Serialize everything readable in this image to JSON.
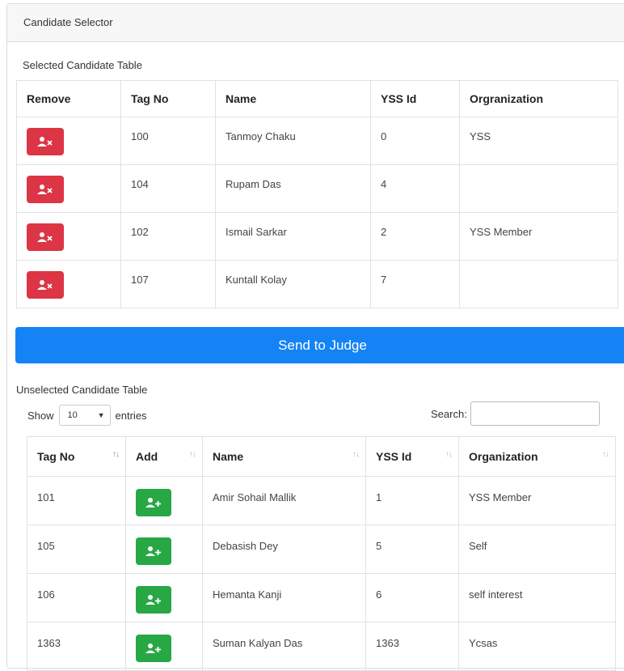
{
  "card": {
    "title": "Candidate Selector"
  },
  "selected": {
    "caption": "Selected Candidate Table",
    "headers": [
      "Remove",
      "Tag No",
      "Name",
      "YSS Id",
      "Orgranization"
    ],
    "rows": [
      {
        "tag": "100",
        "name": "Tanmoy Chaku",
        "yss": "0",
        "org": "YSS"
      },
      {
        "tag": "104",
        "name": "Rupam Das",
        "yss": "4",
        "org": ""
      },
      {
        "tag": "102",
        "name": "Ismail Sarkar",
        "yss": "2",
        "org": "YSS Member"
      },
      {
        "tag": "107",
        "name": "Kuntall Kolay",
        "yss": "7",
        "org": ""
      }
    ],
    "remove_icon": "user-times-icon",
    "remove_color": "#dc3545"
  },
  "send_button": {
    "label": "Send to Judge",
    "color": "#1483f5"
  },
  "unselected": {
    "caption": "Unselected Candidate Table",
    "show_label": "Show",
    "entries_value": "10",
    "entries_label": "entries",
    "search_label": "Search:",
    "search_value": "",
    "headers": [
      "Tag No",
      "Add",
      "Name",
      "YSS Id",
      "Organization"
    ],
    "rows": [
      {
        "tag": "101",
        "name": "Amir Sohail Mallik",
        "yss": "1",
        "org": "YSS Member"
      },
      {
        "tag": "105",
        "name": "Debasish Dey",
        "yss": "5",
        "org": "Self"
      },
      {
        "tag": "106",
        "name": "Hemanta Kanji",
        "yss": "6",
        "org": "self interest"
      },
      {
        "tag": "1363",
        "name": "Suman Kalyan Das",
        "yss": "1363",
        "org": "Ycsas"
      }
    ],
    "add_icon": "user-plus-icon",
    "add_color": "#28a745"
  }
}
